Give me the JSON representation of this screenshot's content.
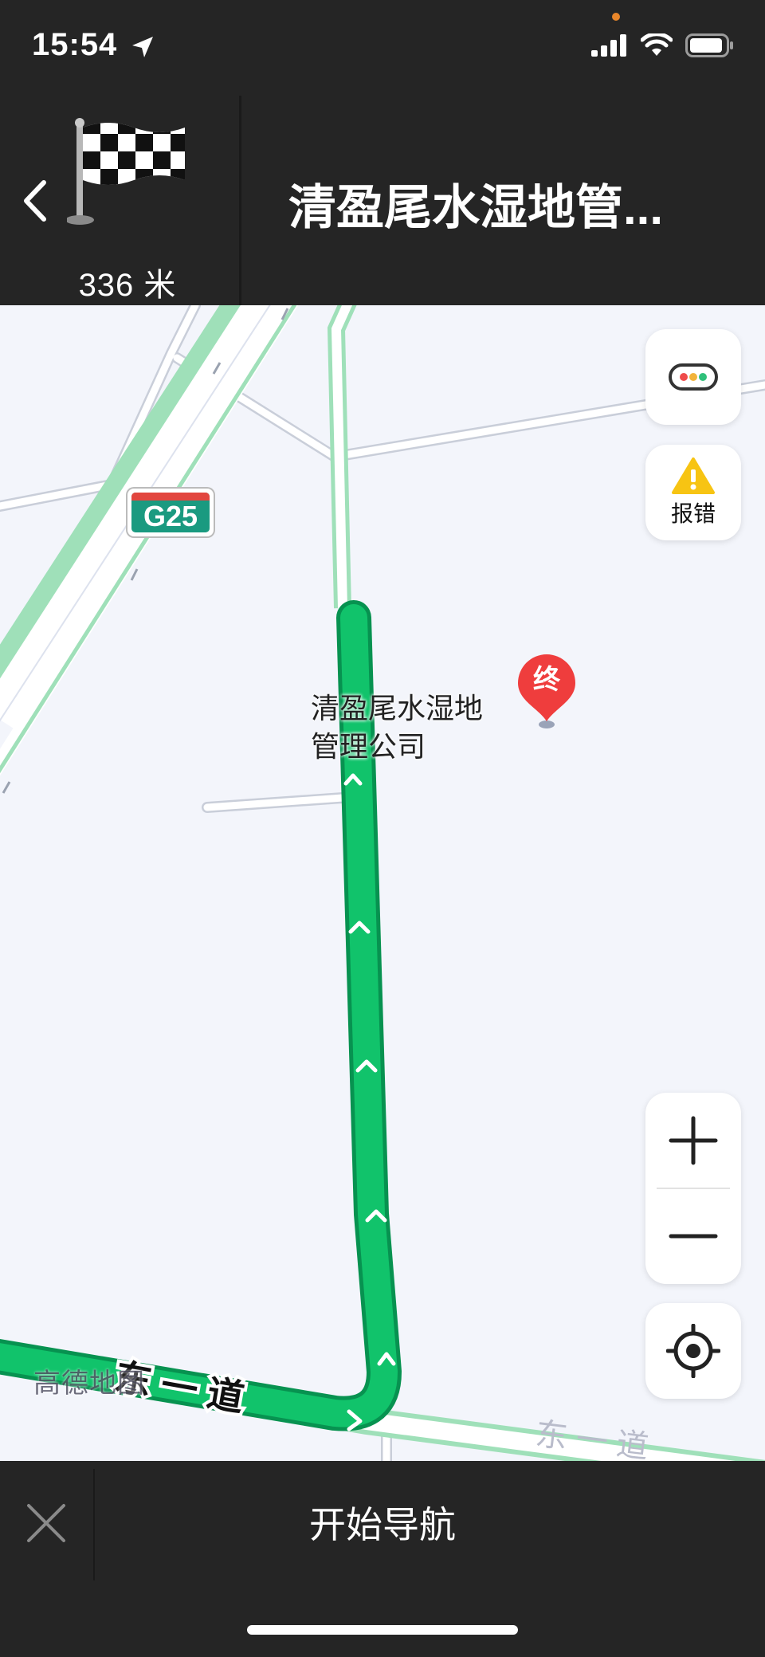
{
  "status_bar": {
    "time": "15:54",
    "icons": [
      "location-arrow-icon",
      "cellular-signal-icon",
      "wifi-icon",
      "battery-icon"
    ],
    "recording_dot_color": "#e8862a"
  },
  "header": {
    "distance": "336 米",
    "destination": "清盈尾水湿地管...",
    "maneuver_icon": "checkered-flag-icon"
  },
  "map": {
    "poi_label": [
      "清盈尾水湿地",
      "管理公司"
    ],
    "end_marker": "终",
    "highway_shield": "G25",
    "road_label": "东 一 道",
    "road_label_faded": "东 一 道",
    "watermark": "高德地图",
    "route_color": "#11c36b"
  },
  "controls": {
    "report_label": "报错",
    "traffic_icon": "traffic-light-icon",
    "report_icon": "warning-icon",
    "zoom_in_icon": "plus-icon",
    "zoom_out_icon": "minus-icon",
    "locate_icon": "locate-icon"
  },
  "bottom": {
    "start_label": "开始导航",
    "close_icon": "close-icon"
  }
}
